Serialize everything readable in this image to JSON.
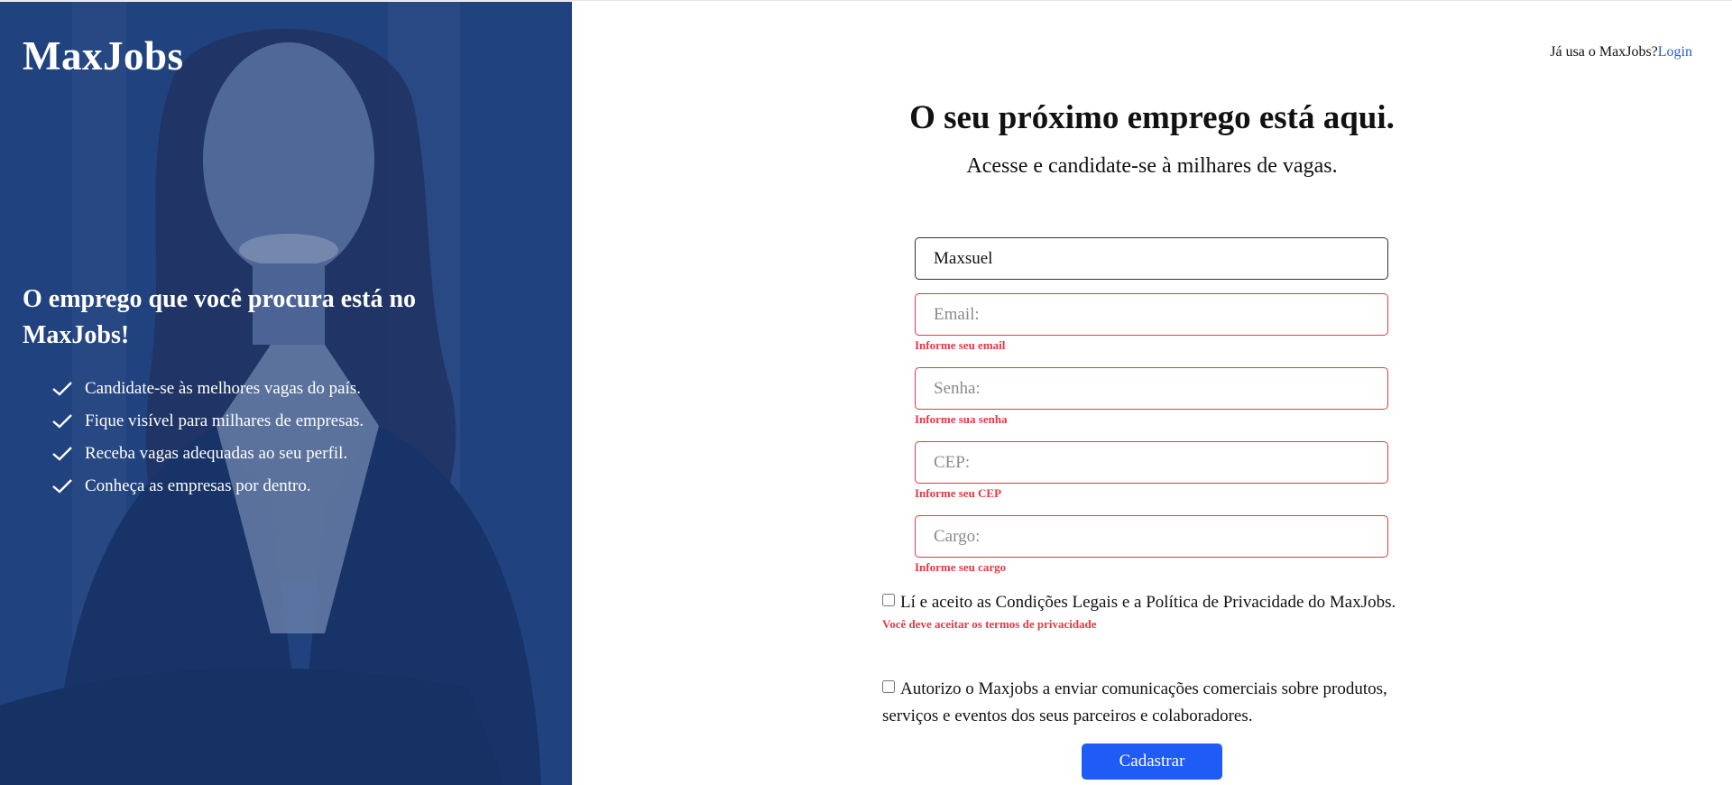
{
  "hero": {
    "brand": "MaxJobs",
    "headline": "O emprego que você procura está no MaxJobs!",
    "benefits": [
      "Candidate-se às melhores vagas do país.",
      "Fique visível para milhares de empresas.",
      "Receba vagas adequadas ao seu perfil.",
      "Conheça as empresas por dentro."
    ],
    "check_icon": "check-icon"
  },
  "header": {
    "login_prompt": "Já usa o MaxJobs?",
    "login_link": "Login"
  },
  "form": {
    "title": "O seu próximo emprego está aqui.",
    "subtitle": "Acesse e candidate-se à milhares de vagas.",
    "name": {
      "value": "Maxsuel"
    },
    "email": {
      "placeholder": "Email:",
      "error": "Informe seu email"
    },
    "password": {
      "placeholder": "Senha:",
      "error": "Informe sua senha"
    },
    "cep": {
      "placeholder": "CEP:",
      "error": "Informe seu CEP"
    },
    "role": {
      "placeholder": "Cargo:",
      "error": "Informe seu cargo"
    },
    "terms": {
      "label": "Lí e aceito as Condições Legais e a Política de Privacidade do MaxJobs.",
      "error": "Você deve aceitar os termos de privacidade",
      "checked": false
    },
    "marketing": {
      "label": "Autorizo o Maxjobs a enviar comunicações comerciais sobre produtos, serviços e eventos dos seus parceiros e colaboradores.",
      "checked": false
    },
    "submit_label": "Cadastrar"
  },
  "colors": {
    "accent": "#1f5cf6",
    "error": "#e53945",
    "hero_overlay": "#1f3d70",
    "link": "#2a5bd7"
  }
}
